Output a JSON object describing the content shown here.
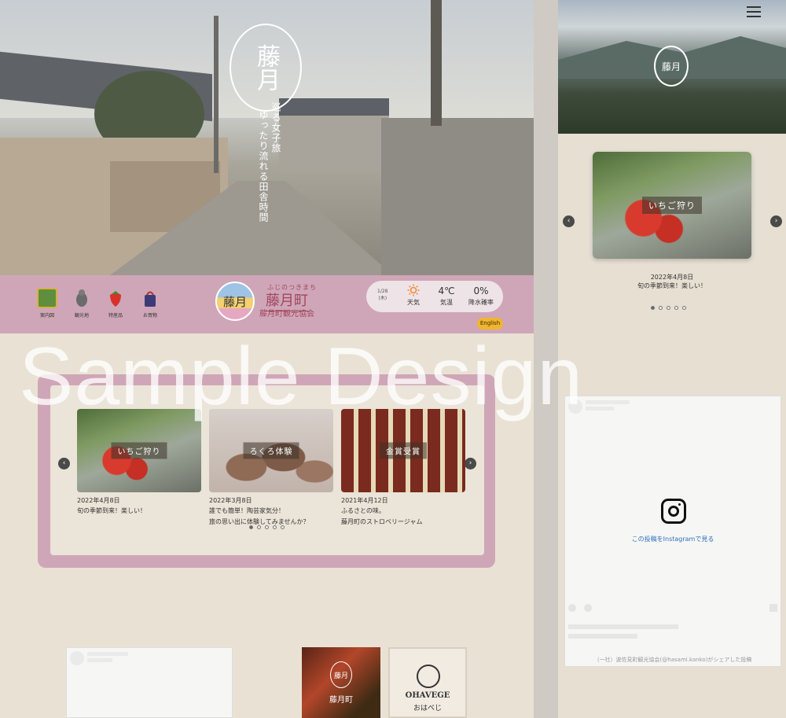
{
  "desktop": {
    "hero": {
      "logo_text": "藤月",
      "tagline_left": "ゆったり流れる田舎時間",
      "tagline_right": "巡る女子旅"
    },
    "nav": [
      {
        "label": "案内図",
        "icon": "map-icon"
      },
      {
        "label": "観光地",
        "icon": "bird-statue-icon"
      },
      {
        "label": "特産品",
        "icon": "strawberry-icon"
      },
      {
        "label": "お買物",
        "icon": "shopping-bag-icon"
      }
    ],
    "brand": {
      "ruby": "ふじのつきまち",
      "name": "藤月町",
      "association": "藤月町観光協会",
      "emblem_text": "藤月"
    },
    "weather": {
      "date": "1/28",
      "weekday": "(木)",
      "weather_label": "天気",
      "temp_value": "4℃",
      "temp_label": "気温",
      "rain_value": "0%",
      "rain_label": "降水確率",
      "icon": "sun-icon"
    },
    "english_label": "English",
    "cards": [
      {
        "tag": "いちご狩り",
        "date": "2022年4月8日",
        "text1": "旬の季節到来！楽しい！",
        "text2": ""
      },
      {
        "tag": "ろくろ体験",
        "date": "2022年3月8日",
        "text1": "誰でも簡単！陶芸家気分！",
        "text2": "旅の思い出に体験してみませんか？"
      },
      {
        "tag": "金賞受賞",
        "date": "2021年4月12日",
        "text1": "ふるさとの味。",
        "text2": "藤月町のストロベリージャム"
      }
    ],
    "banners": {
      "banner1_logo": "藤月",
      "banner1_name": "藤月町",
      "banner2_name": "OHAVEGE",
      "banner2_sub": "おはべじ"
    }
  },
  "mobile": {
    "logo_text": "藤月",
    "card": {
      "tag": "いちご狩り",
      "date": "2022年4月8日",
      "text": "旬の季節到来！楽しい！"
    },
    "instagram": {
      "link_text": "この投稿をInstagramで見る",
      "footer": "（一社）波佐見町観光協会(@hasami.kanko)がシェアした投稿"
    }
  },
  "watermark": "Sample Design",
  "colors": {
    "accent_pink": "#cfa6b7",
    "brand_text": "#a24660",
    "english_button": "#f0b52e",
    "paper": "#e9e2d4"
  }
}
